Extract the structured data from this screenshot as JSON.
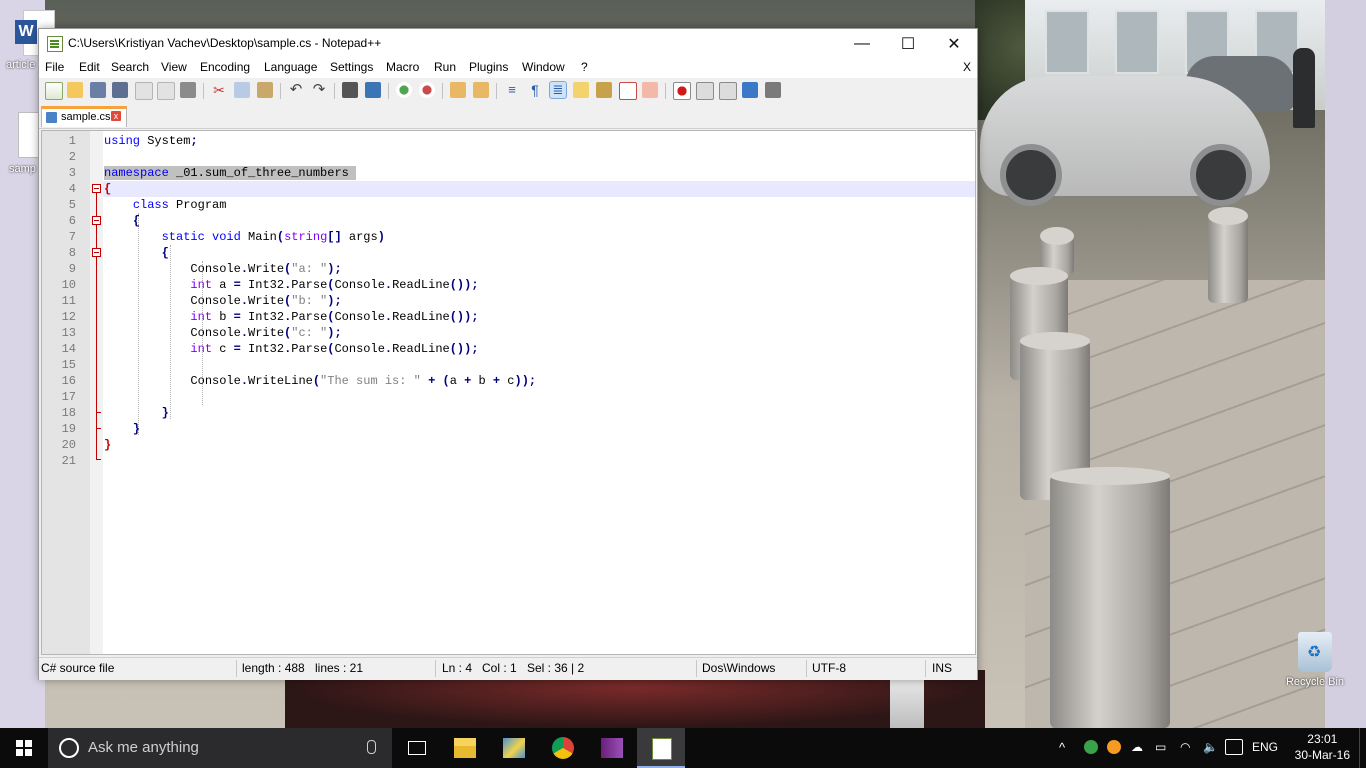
{
  "desktop": {
    "icons": [
      {
        "label": "article"
      },
      {
        "label": "samp"
      }
    ],
    "recycle_bin": "Recycle Bin"
  },
  "window": {
    "title": "C:\\Users\\Kristiyan Vachev\\Desktop\\sample.cs - Notepad++",
    "controls": {
      "minimize": "—",
      "maximize": "☐",
      "close": "✕"
    },
    "menu": [
      "File",
      "Edit",
      "Search",
      "View",
      "Encoding",
      "Language",
      "Settings",
      "Macro",
      "Run",
      "Plugins",
      "Window",
      "?"
    ],
    "menu_close": "X",
    "toolbar": [
      "new-file-icon",
      "open-file-icon",
      "save-icon",
      "save-all-icon",
      "close-icon",
      "close-all-icon",
      "print-icon",
      "cut-icon",
      "copy-icon",
      "paste-icon",
      "undo-icon",
      "redo-icon",
      "find-icon",
      "replace-icon",
      "zoom-in-icon",
      "zoom-out-icon",
      "sync-vertical-icon",
      "sync-horizontal-icon",
      "word-wrap-icon",
      "show-all-chars-icon",
      "indent-guide-icon",
      "user-lang-icon",
      "doc-map-icon",
      "function-list-icon",
      "folder-workspace-icon",
      "record-macro-icon",
      "stop-macro-icon",
      "play-macro-icon",
      "run-macro-multiple-icon",
      "save-macro-icon"
    ]
  },
  "tabs": [
    {
      "name": "sample.cs",
      "close": "x"
    }
  ],
  "editor": {
    "line_numbers": [
      "1",
      "2",
      "3",
      "4",
      "5",
      "6",
      "7",
      "8",
      "9",
      "10",
      "11",
      "12",
      "13",
      "14",
      "15",
      "16",
      "17",
      "18",
      "19",
      "20",
      "21"
    ],
    "current_line": 4
  },
  "status": {
    "file_type": "C# source file",
    "length": "length : 488",
    "lines": "lines : 21",
    "ln": "Ln : 4",
    "col": "Col : 1",
    "sel": "Sel : 36 | 2",
    "eol": "Dos\\Windows",
    "encoding": "UTF-8",
    "mode": "INS"
  },
  "taskbar": {
    "search_placeholder": "Ask me anything",
    "language": "ENG",
    "time": "23:01",
    "date": "30-Mar-16"
  }
}
